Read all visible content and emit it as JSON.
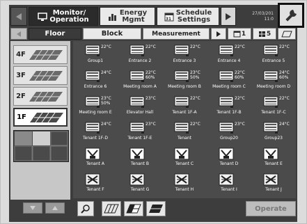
{
  "topbar": {
    "monitor_label": "Monitor/\nOperation",
    "energy_label": "Energy\nMgmt",
    "schedule_label": "Schedule\nSettings",
    "schedule_day": "31",
    "clock_date": "27/03/201",
    "clock_time": "11:0"
  },
  "tabs": {
    "floor": "Floor",
    "block": "Block",
    "measurement": "Measurement",
    "count1": "1",
    "count5": "5"
  },
  "floors": [
    {
      "label": "4F"
    },
    {
      "label": "3F"
    },
    {
      "label": "2F"
    },
    {
      "label": "1F"
    }
  ],
  "units": [
    {
      "name": "Group1",
      "temp": "22°C",
      "humidity": "",
      "type": "ac"
    },
    {
      "name": "Entrance 2",
      "temp": "22°C",
      "humidity": "",
      "type": "ac"
    },
    {
      "name": "Entrance 3",
      "temp": "22°C",
      "humidity": "",
      "type": "ac"
    },
    {
      "name": "Entrance 4",
      "temp": "22°C",
      "humidity": "",
      "type": "ac"
    },
    {
      "name": "Entrance 5",
      "temp": "22°C",
      "humidity": "",
      "type": "ac"
    },
    {
      "name": "Entrance 6",
      "temp": "24°C",
      "humidity": "",
      "type": "ac"
    },
    {
      "name": "Meeting room A",
      "temp": "22°C",
      "humidity": "60%",
      "type": "ac"
    },
    {
      "name": "Meeting room B",
      "temp": "23°C",
      "humidity": "50%",
      "type": "ac"
    },
    {
      "name": "Meeting room C",
      "temp": "22°C",
      "humidity": "60%",
      "type": "ac"
    },
    {
      "name": "Meeting room D",
      "temp": "24°C",
      "humidity": "60%",
      "type": "ac"
    },
    {
      "name": "Meeting room E",
      "temp": "23°C",
      "humidity": "50%",
      "type": "ac"
    },
    {
      "name": "Elevator Hall",
      "temp": "23°C",
      "humidity": "",
      "type": "ac"
    },
    {
      "name": "Tenant 1F-A",
      "temp": "22°C",
      "humidity": "",
      "type": "ac"
    },
    {
      "name": "Tenant 1F-B",
      "temp": "22°C",
      "humidity": "",
      "type": "ac"
    },
    {
      "name": "Tenant 1F-C",
      "temp": "22°C",
      "humidity": "",
      "type": "ac"
    },
    {
      "name": "Tenant 1F-D",
      "temp": "24°C",
      "humidity": "",
      "type": "ac"
    },
    {
      "name": "Tenant 1F-E",
      "temp": "23°C",
      "humidity": "",
      "type": "ac"
    },
    {
      "name": "Tenant",
      "temp": "22°C",
      "humidity": "",
      "type": "ac"
    },
    {
      "name": "Group20",
      "temp": "23°C",
      "humidity": "",
      "type": "ac"
    },
    {
      "name": "Group23",
      "temp": "24°C",
      "humidity": "",
      "type": "ac"
    },
    {
      "name": "Tenant A",
      "temp": "",
      "humidity": "",
      "type": "box"
    },
    {
      "name": "Tenant B",
      "temp": "",
      "humidity": "",
      "type": "box"
    },
    {
      "name": "Tenant C",
      "temp": "",
      "humidity": "",
      "type": "box"
    },
    {
      "name": "Tenant D",
      "temp": "",
      "humidity": "",
      "type": "box"
    },
    {
      "name": "Tenant E",
      "temp": "",
      "humidity": "",
      "type": "box"
    },
    {
      "name": "Tenant F",
      "temp": "",
      "humidity": "",
      "type": "vent"
    },
    {
      "name": "Tenant G",
      "temp": "",
      "humidity": "",
      "type": "vent"
    },
    {
      "name": "Tenant H",
      "temp": "",
      "humidity": "",
      "type": "vent"
    },
    {
      "name": "Tenant I",
      "temp": "",
      "humidity": "",
      "type": "vent"
    },
    {
      "name": "Tenant J",
      "temp": "",
      "humidity": "",
      "type": "vent"
    }
  ],
  "bottom": {
    "operate_label": "Operate"
  }
}
